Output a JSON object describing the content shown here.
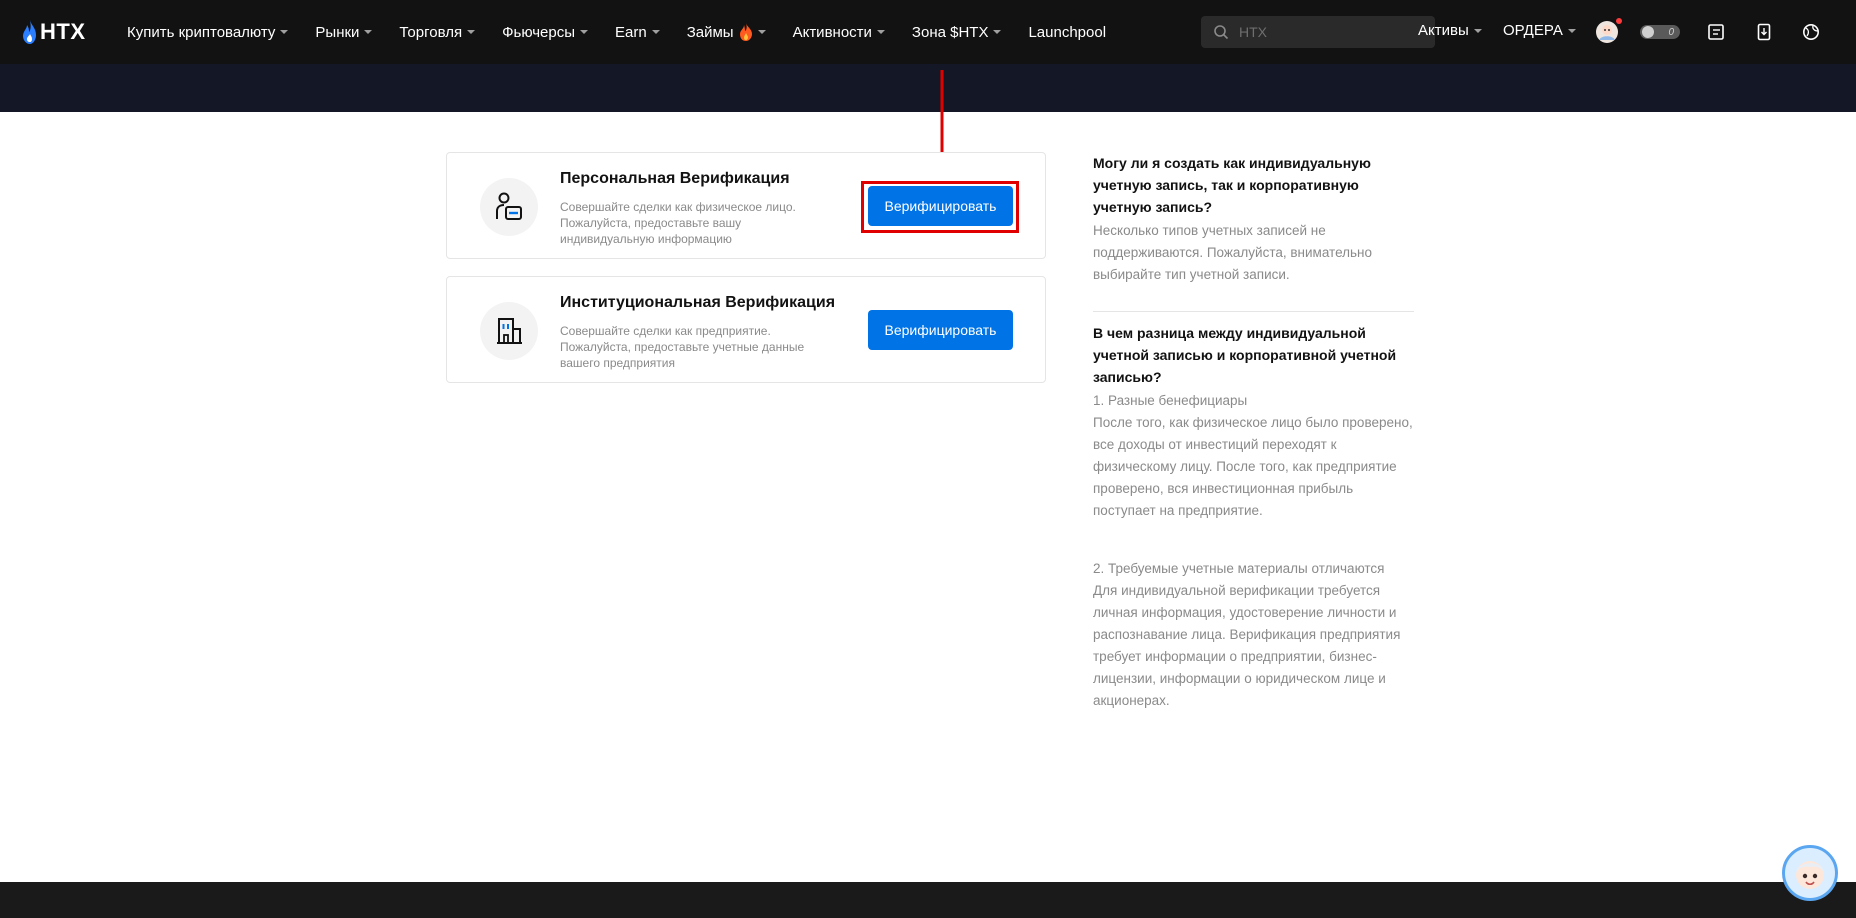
{
  "header": {
    "logo_text": "HTX",
    "nav": [
      {
        "label": "Купить криптовалюту",
        "has_caret": true
      },
      {
        "label": "Рынки",
        "has_caret": true
      },
      {
        "label": "Торговля",
        "has_caret": true
      },
      {
        "label": "Фьючерсы",
        "has_caret": true
      },
      {
        "label": "Earn",
        "has_caret": true
      },
      {
        "label": "Займы",
        "has_caret": true
      },
      {
        "label": "Активности",
        "has_caret": true
      },
      {
        "label": "Зона $HTX",
        "has_caret": true
      },
      {
        "label": "Launchpool",
        "has_caret": false
      }
    ],
    "search_placeholder": "HTX",
    "assets_label": "Активы",
    "orders_label": "ОРДЕРА",
    "toggle_value": "0"
  },
  "cards": [
    {
      "title": "Персональная Верификация",
      "description": "Совершайте сделки как физическое лицо. Пожалуйста, предоставьте вашу индивидуальную информацию",
      "button_label": "Верифицировать",
      "icon": "person-id-icon"
    },
    {
      "title": "Институциональная Верификация",
      "description": "Совершайте сделки как предприятие. Пожалуйста, предоставьте учетные данные вашего предприятия",
      "button_label": "Верифицировать",
      "icon": "building-icon"
    }
  ],
  "faq": [
    {
      "question": "Могу ли я создать как индивидуальную учетную запись, так и корпоративную учетную запись?",
      "answer": "Несколько типов учетных записей не поддерживаются. Пожалуйста, внимательно выбирайте тип учетной записи."
    },
    {
      "question": "В чем разница между индивидуальной учетной записью и корпоративной учетной записью?",
      "answer_1_title": "1. Разные бенефициары",
      "answer_1_text": "После того, как физическое лицо было проверено, все доходы от инвестиций переходят к физическому лицу. После того, как предприятие проверено, вся инвестиционная прибыль поступает на предприятие.",
      "answer_2_title": "2. Требуемые учетные материалы отличаются",
      "answer_2_text": "Для индивидуальной верификации требуется личная информация, удостоверение личности и распознавание лица. Верификация предприятия требует информации о предприятии, бизнес-лицензии, информации о юридическом лице и акционерах."
    }
  ],
  "colors": {
    "accent": "#0073e6",
    "highlight": "#e00000",
    "header_bg": "#121212",
    "banner_bg": "#141826"
  }
}
